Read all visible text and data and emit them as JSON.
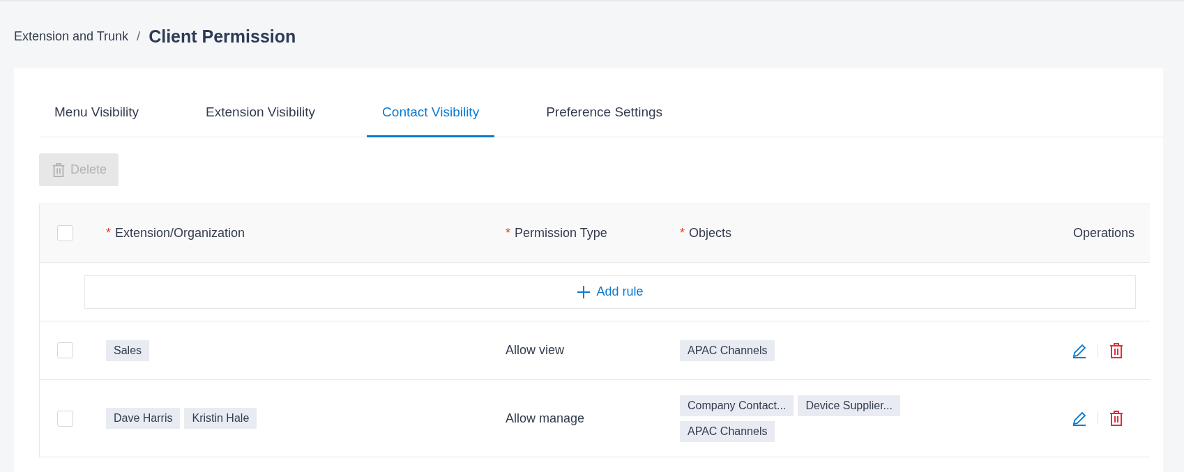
{
  "breadcrumb": {
    "parent": "Extension and Trunk",
    "separator": "/",
    "current": "Client Permission"
  },
  "tabs": [
    {
      "label": "Menu Visibility",
      "selected": false
    },
    {
      "label": "Extension Visibility",
      "selected": false
    },
    {
      "label": "Contact Visibility",
      "selected": true
    },
    {
      "label": "Preference Settings",
      "selected": false
    }
  ],
  "delete_button": {
    "label": "Delete",
    "disabled": true
  },
  "table": {
    "select_all_checked": false,
    "columns": [
      {
        "label": "Extension/Organization",
        "required": true,
        "required_mark": "*"
      },
      {
        "label": "Permission Type",
        "required": true,
        "required_mark": "*"
      },
      {
        "label": "Objects",
        "required": true,
        "required_mark": "*"
      },
      {
        "label": "Operations"
      }
    ],
    "add_rule": "Add rule",
    "rows": [
      {
        "checked": false,
        "members": [
          "Sales"
        ],
        "permission": "Allow view",
        "objects": [
          "APAC Channels"
        ]
      },
      {
        "checked": false,
        "members": [
          "Dave Harris",
          "Kristin Hale"
        ],
        "permission": "Allow manage",
        "objects": [
          "Company Contact...",
          "Device Supplier...",
          "APAC Channels"
        ]
      }
    ]
  }
}
